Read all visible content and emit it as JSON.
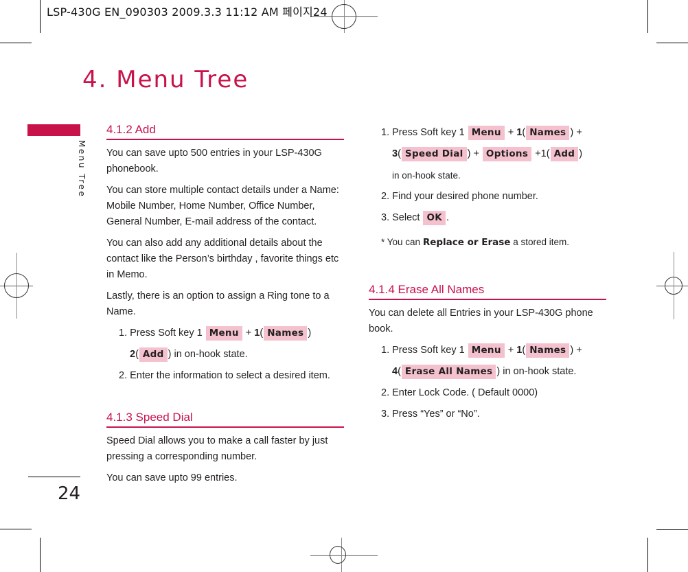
{
  "header": {
    "slug": "LSP-430G EN_090303  2009.3.3 11:12 AM  페이지24"
  },
  "page": {
    "title": "4. Menu Tree",
    "side_label": "Menu Tree",
    "page_number": "24",
    "accent_color": "#c8124a",
    "key_highlight_color": "#f4c1cf"
  },
  "sections": {
    "add": {
      "title": "4.1.2 Add",
      "paragraphs": [
        "You can save upto 500 entries in your LSP-430G phonebook.",
        "You can store multiple contact details under a Name: Mobile Number, Home Number, Office Number, General Number, E-mail address of the contact.",
        "You can also add any additional details about the contact like the Person’s birthday , favorite things etc in Memo.",
        "Lastly, there is an option to assign a Ring tone to a Name."
      ],
      "step1": {
        "prefix": "1. Press Soft key 1",
        "key_menu": "Menu",
        "plus1": "+",
        "num1": "1",
        "key_names": "Names",
        "num2": "2",
        "key_add": "Add",
        "suffix": "in on-hook state."
      },
      "step2": "2. Enter the information to select a desired item."
    },
    "speed_dial": {
      "title": "4.1.3 Speed Dial",
      "paragraphs": [
        "Speed Dial allows you to make a call faster by just pressing a corresponding number.",
        "You can save upto 99 entries."
      ],
      "step1": {
        "prefix": "1. Press Soft key 1",
        "key_menu": "Menu",
        "num1": "1",
        "key_names": "Names",
        "num3": "3",
        "key_speed_dial": "Speed Dial",
        "key_options": "Options",
        "num_add": "+1",
        "key_add": "Add",
        "suffix": "in on-hook state."
      },
      "step2": "2. Find your desired phone number.",
      "step3": {
        "prefix": "3. Select",
        "key_ok": "OK",
        "suffix": "."
      },
      "note": {
        "prefix": "* You can",
        "bold": "Replace or Erase",
        "suffix": "a stored item."
      }
    },
    "erase_all": {
      "title": "4.1.4 Erase All Names",
      "paragraphs": [
        "You can delete all Entries in your LSP-430G phone book."
      ],
      "step1": {
        "prefix": "1. Press Soft key 1",
        "key_menu": "Menu",
        "num1": "1",
        "key_names": "Names",
        "num4": "4",
        "key_erase_all": "Erase All Names",
        "suffix": "in on-hook state."
      },
      "step2": "2. Enter Lock Code. ( Default 0000)",
      "step3": "3. Press “Yes” or “No”."
    }
  }
}
